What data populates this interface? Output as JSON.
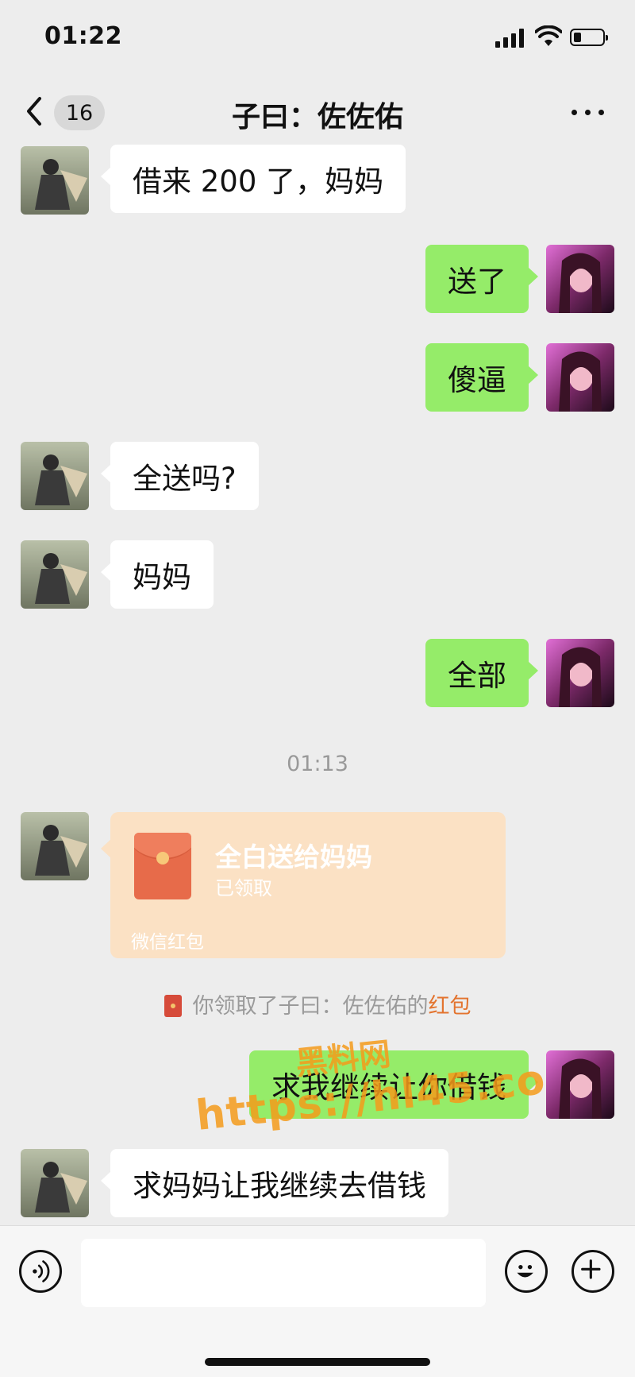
{
  "status_bar": {
    "time": "01:22"
  },
  "nav": {
    "unread_count": "16",
    "title": "子曰：佐佐佑"
  },
  "messages": [
    {
      "side": "left",
      "text": "借来 200 了，妈妈"
    },
    {
      "side": "right",
      "text": "送了"
    },
    {
      "side": "right",
      "text": "傻逼"
    },
    {
      "side": "left",
      "text": "全送吗?"
    },
    {
      "side": "left",
      "text": "妈妈"
    },
    {
      "side": "right",
      "text": "全部"
    },
    {
      "side": "right",
      "text": "求我继续让你借钱"
    },
    {
      "side": "left",
      "text": "求妈妈让我继续去借钱"
    }
  ],
  "time_divider": "01:13",
  "red_packet": {
    "title": "全白送给妈妈",
    "status": "已领取",
    "footer": "微信红包"
  },
  "system_note": {
    "text": "你领取了子曰：佐佐佑的",
    "link": "红包"
  },
  "watermark": {
    "line1": "黑料网",
    "line2": "https://hl45.co"
  },
  "input": {
    "placeholder": ""
  },
  "icons": {
    "back": "chevron-left-icon",
    "more": "more-icon",
    "voice": "voice-icon",
    "emoji": "emoji-icon",
    "plus": "plus-icon"
  }
}
